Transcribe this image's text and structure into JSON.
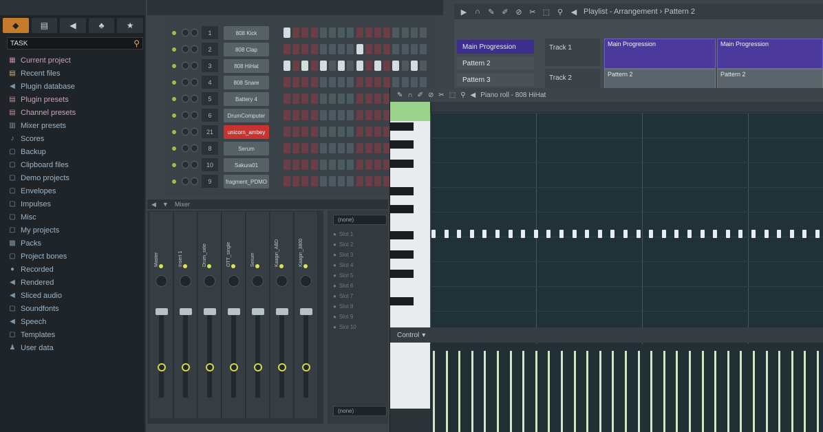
{
  "browser": {
    "tabs": [
      {
        "label": "◆",
        "icon": "arrows-icon"
      },
      {
        "label": "▤",
        "icon": "file-icon"
      },
      {
        "label": "◀",
        "icon": "speaker-icon"
      },
      {
        "label": "♣",
        "icon": "plugin-icon"
      },
      {
        "label": "★",
        "icon": "star-icon"
      }
    ],
    "search_value": "TASK",
    "items": [
      {
        "label": "Current project",
        "icon": "▦",
        "tone": "hot"
      },
      {
        "label": "Recent files",
        "icon": "▤",
        "tone": "warm"
      },
      {
        "label": "Plugin database",
        "icon": "◀",
        "tone": ""
      },
      {
        "label": "Plugin presets",
        "icon": "▤",
        "tone": "hot"
      },
      {
        "label": "Channel presets",
        "icon": "▤",
        "tone": "hot"
      },
      {
        "label": "Mixer presets",
        "icon": "▥",
        "tone": ""
      },
      {
        "label": "Scores",
        "icon": "♪",
        "tone": ""
      },
      {
        "label": "Backup",
        "icon": "▢",
        "tone": ""
      },
      {
        "label": "Clipboard files",
        "icon": "▢",
        "tone": ""
      },
      {
        "label": "Demo projects",
        "icon": "▢",
        "tone": ""
      },
      {
        "label": "Envelopes",
        "icon": "▢",
        "tone": ""
      },
      {
        "label": "Impulses",
        "icon": "▢",
        "tone": ""
      },
      {
        "label": "Misc",
        "icon": "▢",
        "tone": ""
      },
      {
        "label": "My projects",
        "icon": "▢",
        "tone": ""
      },
      {
        "label": "Packs",
        "icon": "▩",
        "tone": ""
      },
      {
        "label": "Project bones",
        "icon": "▢",
        "tone": ""
      },
      {
        "label": "Recorded",
        "icon": "●",
        "tone": ""
      },
      {
        "label": "Rendered",
        "icon": "◀",
        "tone": ""
      },
      {
        "label": "Sliced audio",
        "icon": "◀",
        "tone": ""
      },
      {
        "label": "Soundfonts",
        "icon": "▢",
        "tone": ""
      },
      {
        "label": "Speech",
        "icon": "◀",
        "tone": ""
      },
      {
        "label": "Templates",
        "icon": "▢",
        "tone": ""
      },
      {
        "label": "User data",
        "icon": "♟",
        "tone": ""
      }
    ]
  },
  "channel_rack": {
    "channels": [
      {
        "num": "1",
        "name": "808 Kick"
      },
      {
        "num": "2",
        "name": "808 Clap"
      },
      {
        "num": "3",
        "name": "808 HiHat"
      },
      {
        "num": "4",
        "name": "808 Snare"
      },
      {
        "num": "5",
        "name": "Battery 4"
      },
      {
        "num": "6",
        "name": "DrumComputer"
      },
      {
        "num": "21",
        "name": "unicorn_ambey",
        "highlight": true
      },
      {
        "num": "8",
        "name": "Serum"
      },
      {
        "num": "10",
        "name": "Sakura01"
      },
      {
        "num": "9",
        "name": "fragment_PDMO"
      }
    ]
  },
  "mixer": {
    "title": "Mixer",
    "strips": [
      {
        "name": "Master"
      },
      {
        "name": "Insert 1"
      },
      {
        "name": "Drum_side"
      },
      {
        "name": "OTT_single"
      },
      {
        "name": "Serum"
      },
      {
        "name": "Kaagin_ABD"
      },
      {
        "name": "Kaagin_3800"
      }
    ],
    "slot_select": "(none)",
    "slots": [
      "Slot 1",
      "Slot 2",
      "Slot 3",
      "Slot 4",
      "Slot 5",
      "Slot 6",
      "Slot 7",
      "Slot 8",
      "Slot 9",
      "Slot 10"
    ],
    "bottom_select": "(none)"
  },
  "playlist": {
    "toolbar_title": "Playlist - Arrangement › Pattern 2",
    "patterns": [
      "Main Progression",
      "Pattern 2",
      "Pattern 3"
    ],
    "tracks": [
      "Track 1",
      "Track 2"
    ],
    "clips": [
      {
        "label": "Main Progression",
        "track": 0,
        "color": "purple"
      },
      {
        "label": "Main Progression",
        "track": 0,
        "color": "purple"
      },
      {
        "label": "Pattern 2",
        "track": 1,
        "color": "grey"
      },
      {
        "label": "Pattern 2",
        "track": 1,
        "color": "grey"
      }
    ]
  },
  "piano_roll": {
    "toolbar_title": "Piano roll - 808 HiHat",
    "controller_label": "Control"
  }
}
